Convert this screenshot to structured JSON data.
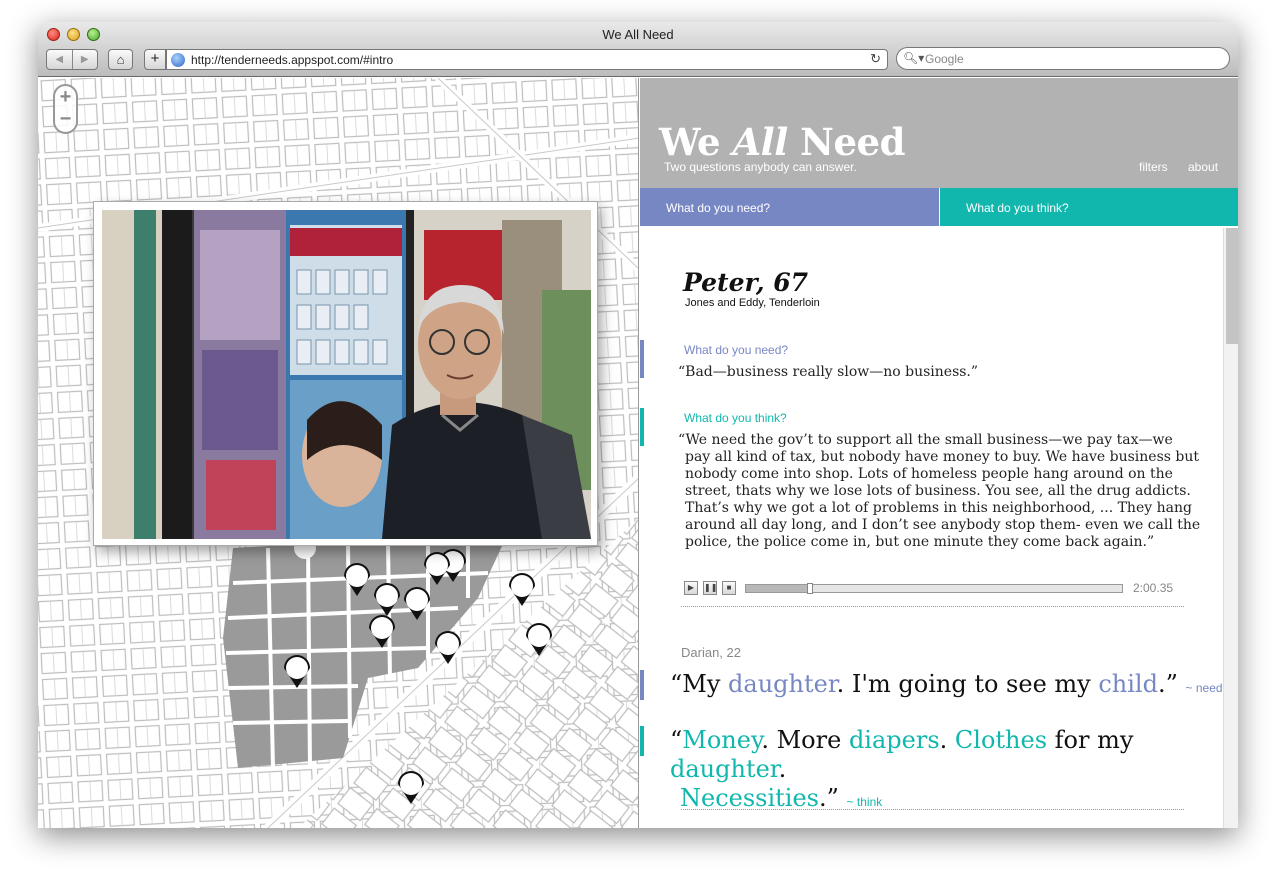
{
  "browser": {
    "title": "We All Need",
    "back_icon": "back-arrow-icon",
    "forward_icon": "forward-arrow-icon",
    "url": "http://tenderneeds.appspot.com/#intro",
    "search_placeholder": "Google"
  },
  "map": {
    "zoom_in": "+",
    "zoom_out": "−"
  },
  "site": {
    "logo_prefix": "We ",
    "logo_emphasis": "All",
    "logo_suffix": " Need",
    "tagline": "Two questions anybody can answer.",
    "nav": [
      "filters",
      "about"
    ],
    "tabs": {
      "need": "What do you need?",
      "think": "What do you think?"
    },
    "colors": {
      "need": "#7787c4",
      "think": "#11b7ad",
      "header": "#b2b2b2"
    }
  },
  "entry1": {
    "name": "Peter, 67",
    "location": "Jones and Eddy, Tenderloin",
    "need_label": "What do you need?",
    "need_quote": "“Bad—business really slow—no business.”",
    "think_label": "What do you think?",
    "think_quote_lines": [
      "“We need the gov’t to support all the small business—we pay tax—we",
      "pay all kind of tax, but nobody have money to buy. We have business but",
      "nobody come into shop. Lots of homeless people hang around on the",
      "street, thats why we lose lots of business. You see, all the drug addicts.",
      "That’s why we got a lot of problems in this neighborhood, ... They hang",
      "around all day long, and I don’t see anybody stop them- even we call the",
      "police, the police come in, but one minute they come back again.”"
    ],
    "audio_time": "2:00.35",
    "audio_progress": 0.17
  },
  "entry2": {
    "name": "Darian, 22",
    "need_parts": [
      "“My ",
      "daughter",
      ". I'm going to see my ",
      "child",
      ".”"
    ],
    "need_tag": "~ need",
    "think_parts": [
      "“",
      "Money",
      ". More ",
      "diapers",
      ". ",
      "Clothes",
      " for my ",
      "daughter",
      "."
    ],
    "think_parts2": [
      "Necessities",
      ".”"
    ],
    "think_tag": "~ think"
  }
}
